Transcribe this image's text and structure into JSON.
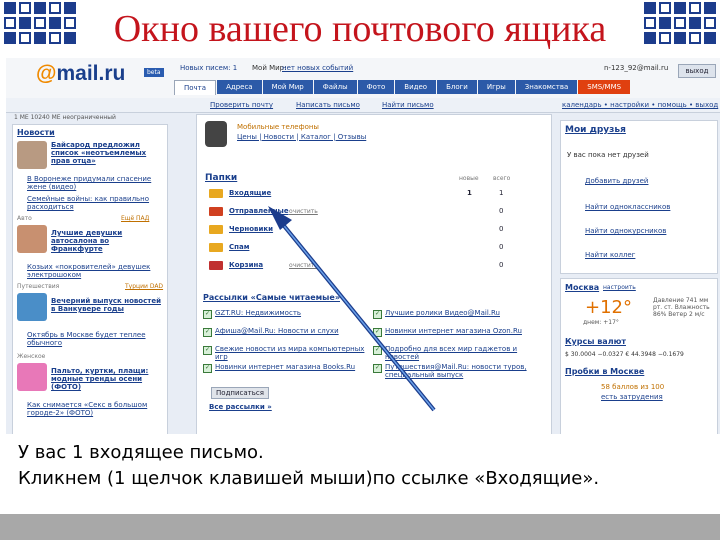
{
  "slide": {
    "title": "Окно вашего почтового ящика",
    "caption_line1": "У вас 1 входящее письмо.",
    "caption_line2": "Кликнем (1 щелчок клавишей мыши)по ссылке «Входящие».",
    "title_color": "#c4141c",
    "accent_color": "#1c3c8c"
  },
  "header": {
    "logo_at": "@",
    "logo_text": "mail.ru",
    "beta": "beta",
    "new_letters": "Новых писем: 1",
    "my_world": "Мой Мир:",
    "no_events": "нет новых событий",
    "user_email": "n-123_92@mail.ru",
    "exit": "выход"
  },
  "tabs": [
    "Почта",
    "Адреса",
    "Мой Мир",
    "Файлы",
    "Фото",
    "Видео",
    "Блоги",
    "Игры",
    "Знакомства",
    "SMS/MMS"
  ],
  "toolbar": {
    "check_mail": "Проверить почту",
    "write": "Написать письмо",
    "find": "Найти письмо",
    "right_links": "календарь • настройки • помощь • выход"
  },
  "left": {
    "weather_row": "1 ME     10240 ME     неограниченный",
    "news_title": "Новости",
    "news_items": [
      "Байсарод предложил список «неотъемлемых прав отца»",
      "В Воронеже придумали спасение жене (видео)",
      "Семейные войны: как правильно расходиться",
      "Лучшие девушки автосалона во Франкфурте",
      "Козьих «покровителей» девушек электрошоком",
      "Вечерний выпуск новостей в Ванкувере годы",
      "Октябрь в Москве будет теплее обычного",
      "Пальто, куртки, плащи: модные тренды осени (ФОТО)",
      "Как снимается «Секс в большом городе-2» (ФОТО)"
    ],
    "section_auto": "Авто",
    "section_travel": "Путешествия",
    "section_women": "Женское",
    "more_auto": "Ещё ПАД",
    "more_travel": "Турции DAD"
  },
  "center": {
    "phones_title": "Мобильные телефоны",
    "phones_links": "Цены | Новости | Каталог | Отзывы",
    "folders_title": "Папки",
    "col_new": "новые",
    "col_all": "всего",
    "folders": [
      {
        "name": "Входящие",
        "new": "1",
        "total": "1",
        "clear": ""
      },
      {
        "name": "Отправленные",
        "new": "",
        "total": "0",
        "clear": "очистить"
      },
      {
        "name": "Черновики",
        "new": "",
        "total": "0",
        "clear": ""
      },
      {
        "name": "Спам",
        "new": "",
        "total": "0",
        "clear": ""
      },
      {
        "name": "Корзина",
        "new": "",
        "total": "0",
        "clear": "очистить"
      }
    ],
    "subs_title": "Рассылки «Самые читаемые»",
    "subs_left": [
      "GZT.RU: Недвижимость",
      "Афиша@Mail.Ru: Новости и слухи",
      "Свежие новости из мира компьютерных игр",
      "Новинки интернет магазина Books.Ru"
    ],
    "subs_right": [
      "Лучшие ролики Видео@Mail.Ru",
      "Новинки интернет магазина Ozon.Ru",
      "Подробно для всех мир гаджетов и новостей",
      "Путешествия@Mail.Ru: новости туров, специальный выпуск"
    ],
    "subscribe": "Подписаться",
    "all_subs": "Все рассылки »"
  },
  "right": {
    "friends_title": "Мои друзья",
    "friends_none": "У вас пока нет друзей",
    "friends_links": [
      "Добавить друзей",
      "Найти одноклассников",
      "Найти однокурсников",
      "Найти коллег"
    ],
    "city": "Москва",
    "city_setup": "настроить",
    "temp": "+12°",
    "temp_night": "днем: +17°",
    "weather_info": "Давление 741 мм рт. ст. Влажность 86% Ветер 2 м/с",
    "currency_title": "Курсы валют",
    "currency_values": "$ 30.0004 −0.0327    € 44.3948 −0.1679",
    "traffic_title": "Пробки в Москве",
    "traffic_score": "58 баллов из 100",
    "traffic_status": "есть затрудения"
  }
}
